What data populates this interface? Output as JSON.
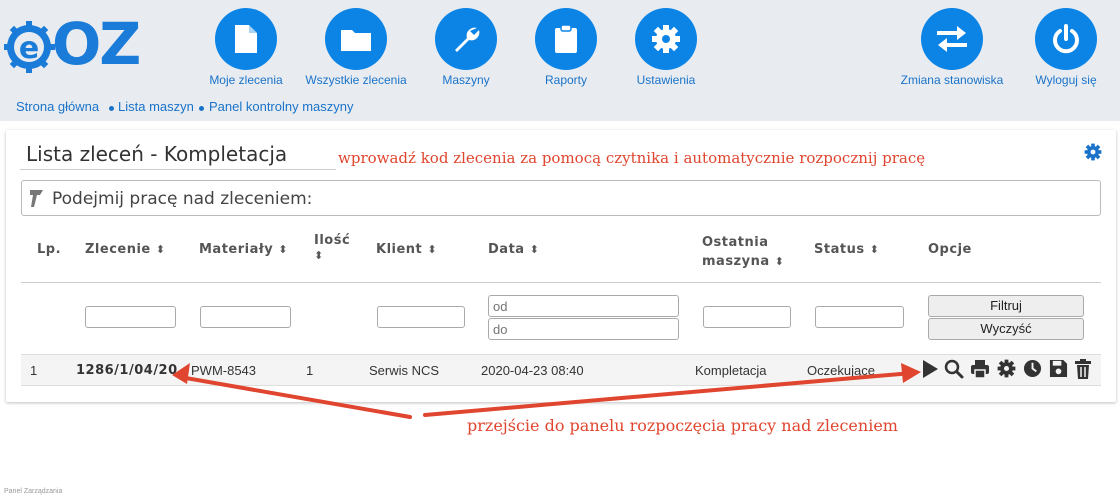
{
  "app": {
    "logo_text": "OZ",
    "logo_letter": "e"
  },
  "nav": {
    "items": [
      {
        "label": "Moje zlecenia",
        "icon": "document-icon"
      },
      {
        "label": "Wszystkie zlecenia",
        "icon": "folder-icon"
      },
      {
        "label": "Maszyny",
        "icon": "wrench-icon"
      },
      {
        "label": "Raporty",
        "icon": "clipboard-icon"
      },
      {
        "label": "Ustawienia",
        "icon": "gear-icon"
      }
    ],
    "right": [
      {
        "label": "Zmiana stanowiska",
        "icon": "swap-arrows-icon"
      },
      {
        "label": "Wyloguj się",
        "icon": "power-icon"
      }
    ]
  },
  "breadcrumb": [
    "Strona główna",
    "Lista maszyn",
    "Panel kontrolny maszyny"
  ],
  "page": {
    "title": "Lista zleceń - Kompletacja",
    "hint": "wprowadź kod zlecenia za pomocą czytnika i automatycznie rozpocznij pracę",
    "scan_label": "Podejmij pracę nad zleceniem:"
  },
  "table": {
    "headers": {
      "lp": "Lp.",
      "zlecenie": "Zlecenie",
      "materialy": "Materiały",
      "ilosc": "Ilość",
      "klient": "Klient",
      "data": "Data",
      "ostatnia1": "Ostatnia",
      "ostatnia2": "maszyna",
      "status": "Status",
      "opcje": "Opcje"
    },
    "filters": {
      "date_from_placeholder": "od",
      "date_to_placeholder": "do",
      "filter_button": "Filtruj",
      "clear_button": "Wyczyść"
    },
    "rows": [
      {
        "lp": "1",
        "zlecenie": "1286/1/04/20",
        "materialy": "PWM-8543",
        "ilosc": "1",
        "klient": "Serwis NCS",
        "data": "2020-04-23 08:40",
        "ostatnia": "Kompletacja",
        "status": "Oczekujące"
      }
    ]
  },
  "annotation": {
    "text": "przejście do panelu rozpoczęcia pracy nad zleceniem"
  },
  "footer": {
    "tiny_text": "Panel Zarządzania"
  },
  "colors": {
    "accent": "#0b84e6",
    "annotation": "#e0452f",
    "link": "#1a73c9"
  }
}
